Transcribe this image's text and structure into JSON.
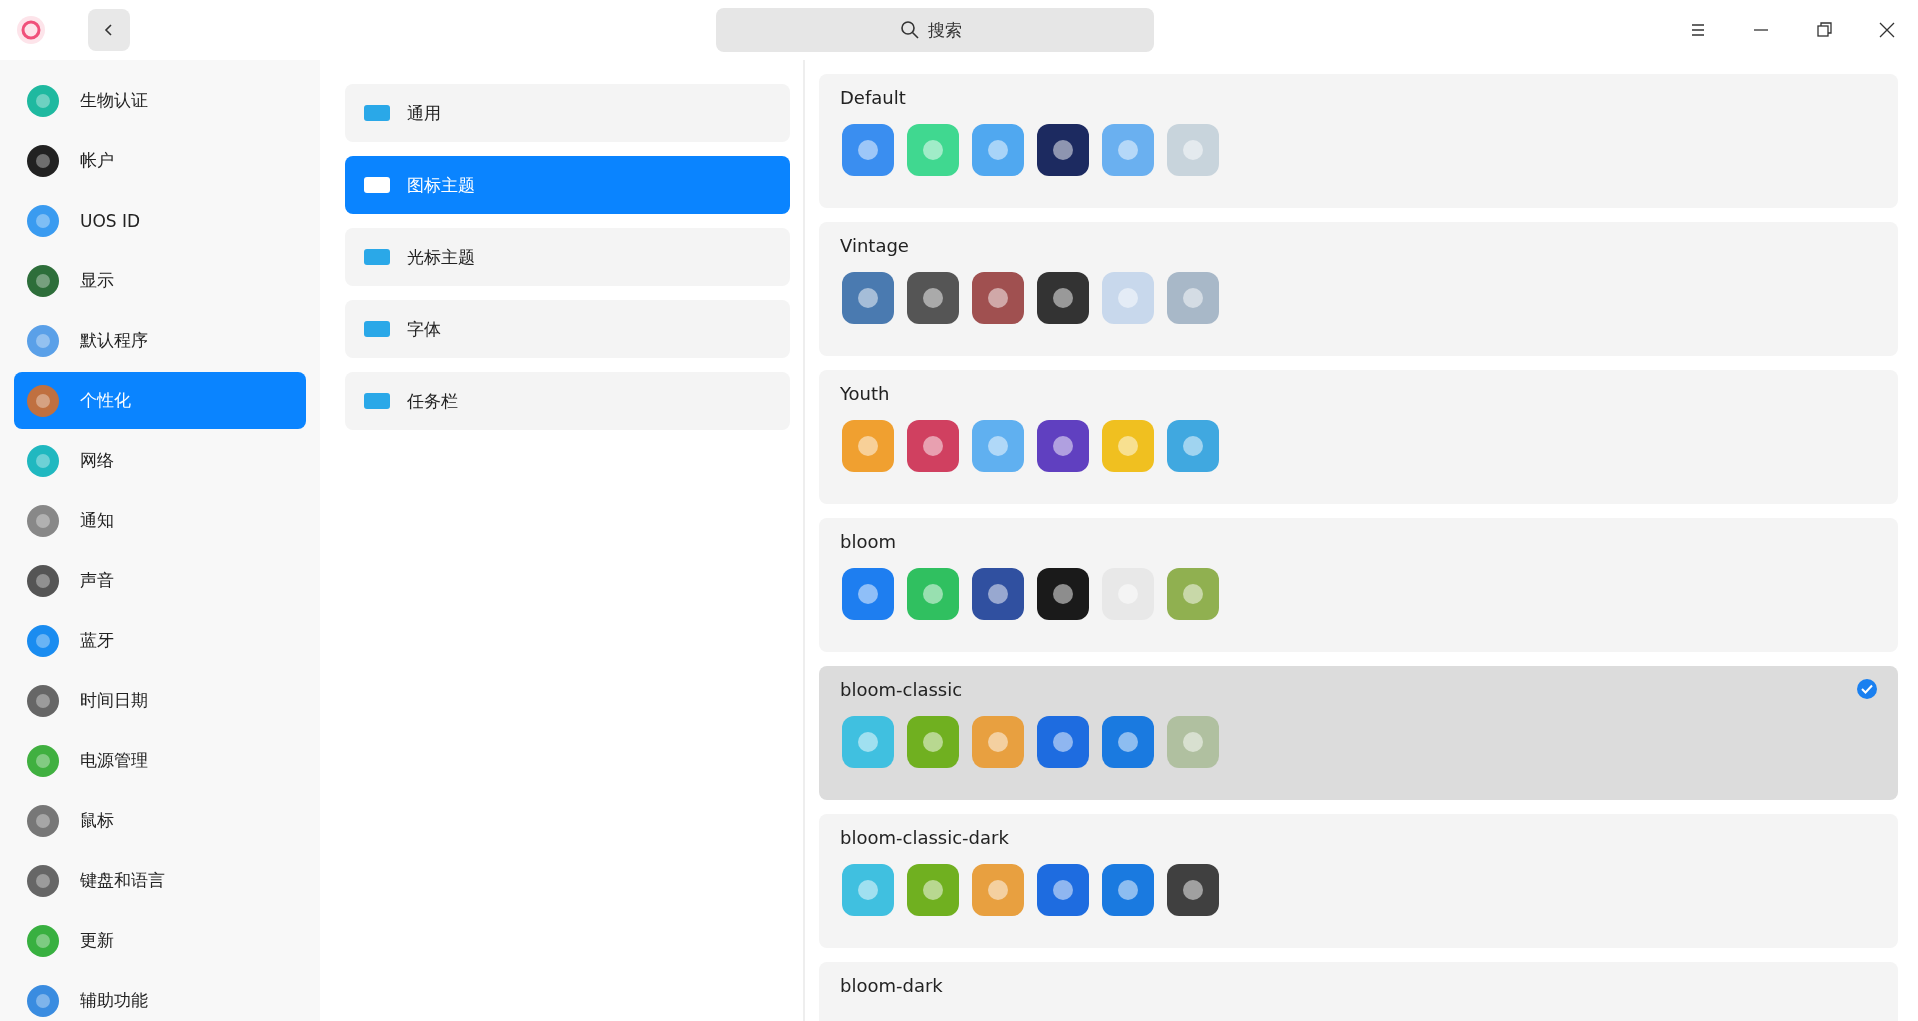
{
  "search": {
    "placeholder": "搜索"
  },
  "sidebar": {
    "items": [
      {
        "label": "生物认证",
        "selected": false
      },
      {
        "label": "帐户",
        "selected": false
      },
      {
        "label": "UOS ID",
        "selected": false
      },
      {
        "label": "显示",
        "selected": false
      },
      {
        "label": "默认程序",
        "selected": false
      },
      {
        "label": "个性化",
        "selected": true
      },
      {
        "label": "网络",
        "selected": false
      },
      {
        "label": "通知",
        "selected": false
      },
      {
        "label": "声音",
        "selected": false
      },
      {
        "label": "蓝牙",
        "selected": false
      },
      {
        "label": "时间日期",
        "selected": false
      },
      {
        "label": "电源管理",
        "selected": false
      },
      {
        "label": "鼠标",
        "selected": false
      },
      {
        "label": "键盘和语言",
        "selected": false
      },
      {
        "label": "更新",
        "selected": false
      },
      {
        "label": "辅助功能",
        "selected": false
      }
    ]
  },
  "categories": [
    {
      "label": "通用",
      "selected": false
    },
    {
      "label": "图标主题",
      "selected": true
    },
    {
      "label": "光标主题",
      "selected": false
    },
    {
      "label": "字体",
      "selected": false
    },
    {
      "label": "任务栏",
      "selected": false
    }
  ],
  "themes": [
    {
      "name": "Default",
      "selected": false
    },
    {
      "name": "Vintage",
      "selected": false
    },
    {
      "name": "Youth",
      "selected": false
    },
    {
      "name": "bloom",
      "selected": false
    },
    {
      "name": "bloom-classic",
      "selected": true
    },
    {
      "name": "bloom-classic-dark",
      "selected": false
    },
    {
      "name": "bloom-dark",
      "selected": false
    }
  ]
}
